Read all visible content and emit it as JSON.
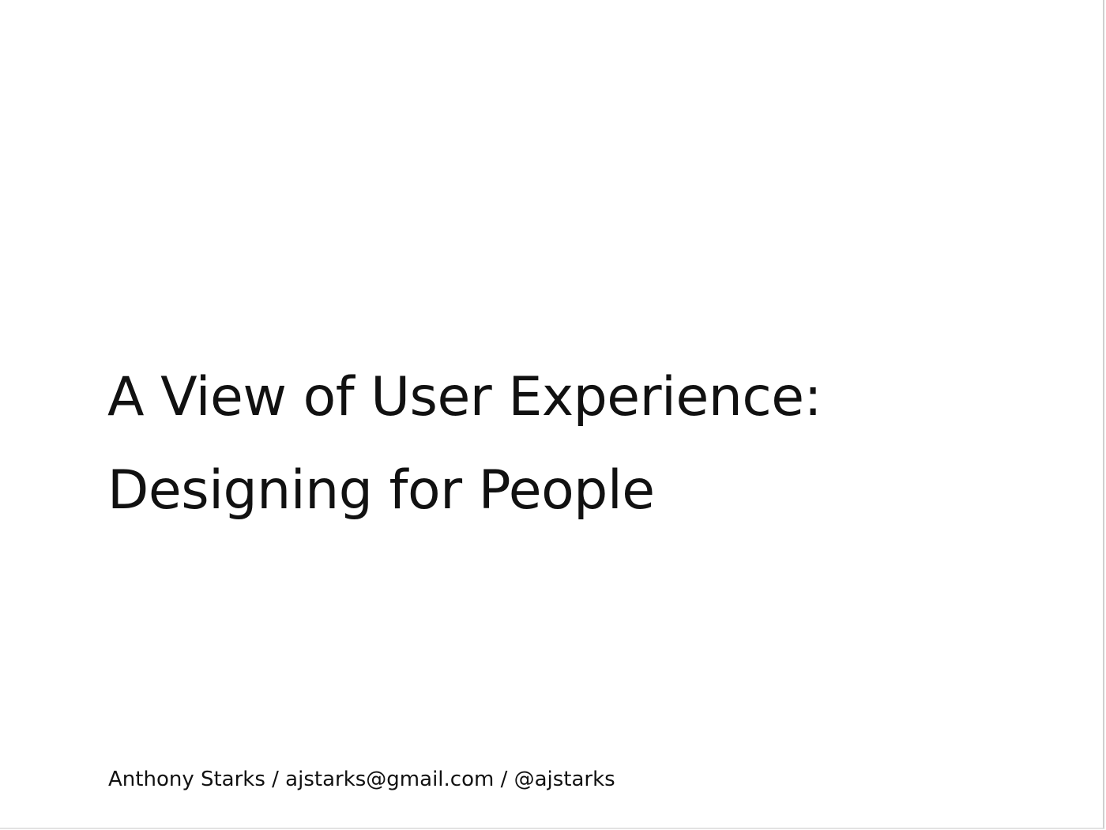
{
  "slide": {
    "title_lines": [
      "A View of User Experience:",
      "Designing for People"
    ],
    "footer": "Anthony Starks / ajstarks@gmail.com / @ajstarks"
  }
}
